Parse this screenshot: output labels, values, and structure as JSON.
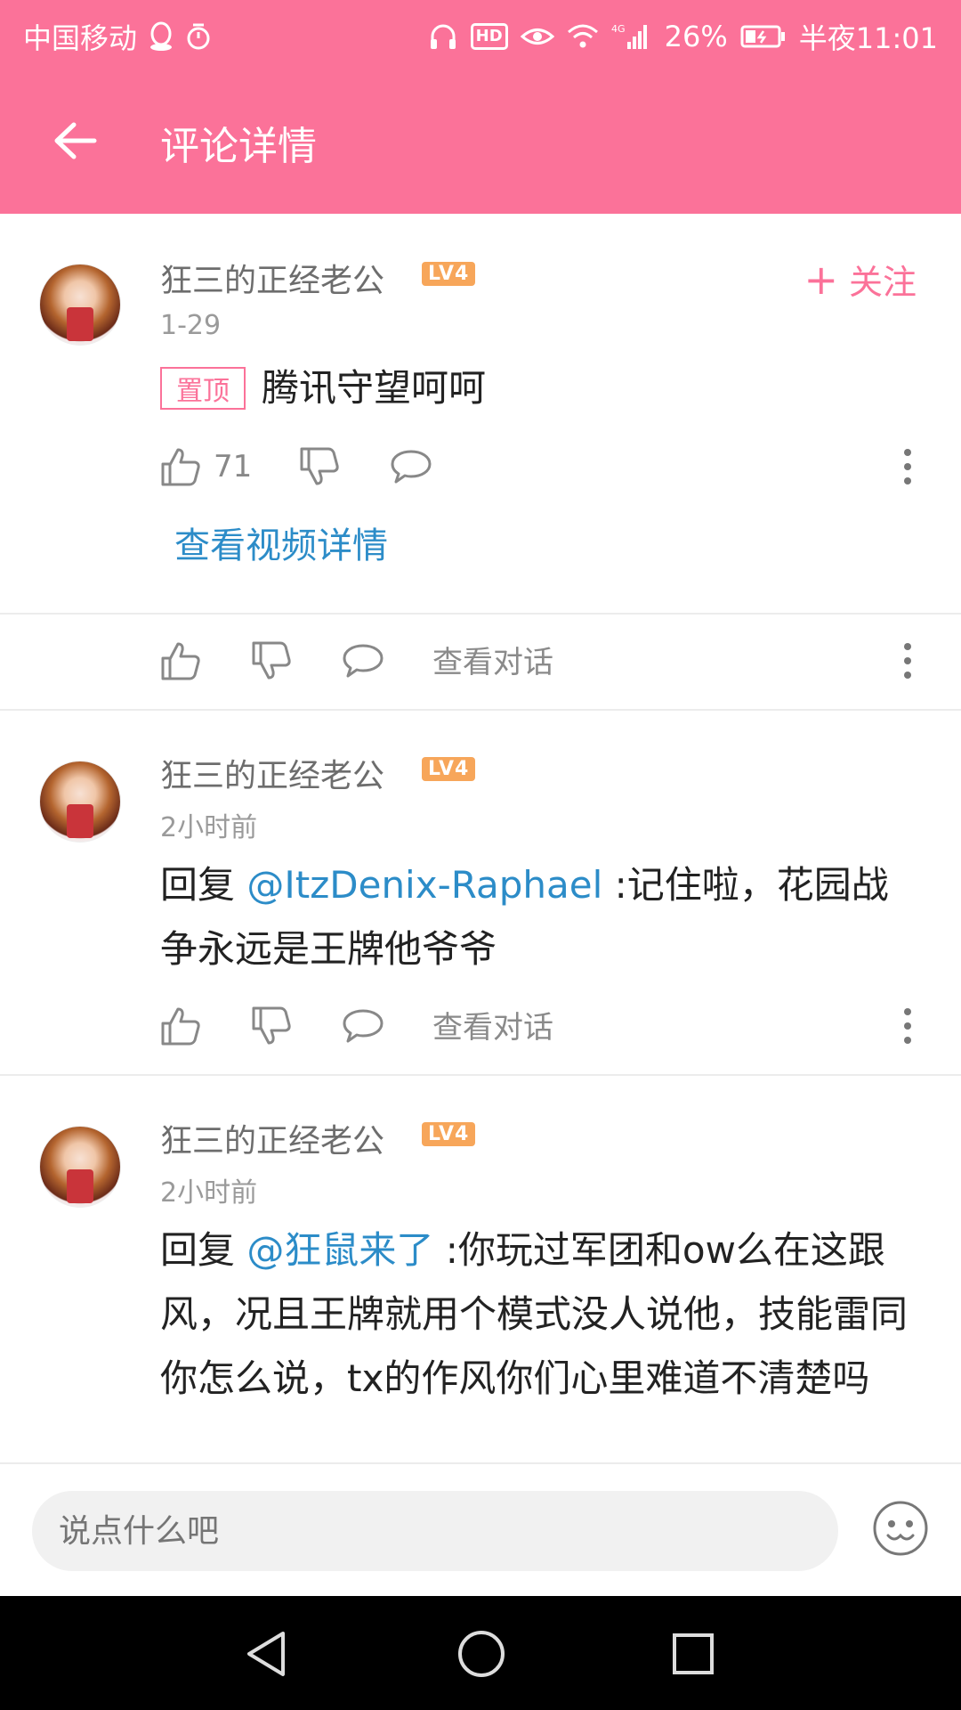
{
  "status_bar": {
    "carrier": "中国移动",
    "battery": "26%",
    "time": "半夜11:01",
    "network": "4G",
    "hd_label": "HD"
  },
  "header": {
    "title": "评论详情",
    "background_color": "#fb7299"
  },
  "main_comment": {
    "username": "狂三的正经老公",
    "level": "LV4",
    "date": "1-29",
    "follow_label": "关注",
    "pin_label": "置顶",
    "text": "腾讯守望呵呵",
    "likes": "71",
    "video_link": "查看视频详情"
  },
  "dialog_label": "查看对话",
  "replies": [
    {
      "username": "狂三的正经老公",
      "level": "LV4",
      "time": "2小时前",
      "prefix": "回复 ",
      "mention": "@ItzDenix-Raphael",
      "text": " :记住啦，花园战争永远是王牌他爷爷"
    },
    {
      "username": "狂三的正经老公",
      "level": "LV4",
      "time": "2小时前",
      "prefix": "回复 ",
      "mention": "@狂鼠来了",
      "text": " :你玩过军团和ow么在这跟风，况且王牌就用个模式没人说他，技能雷同你怎么说，tx的作风你们心里难道不清楚吗"
    }
  ],
  "input": {
    "placeholder": "说点什么吧"
  },
  "colors": {
    "accent": "#fb7299",
    "link": "#2c8cc8",
    "level_badge": "#f7a65a"
  }
}
